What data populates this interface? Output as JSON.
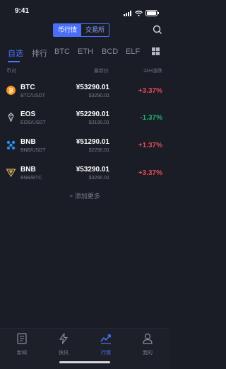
{
  "status": {
    "time": "9:41"
  },
  "segment": {
    "active": "币行情",
    "inactive": "交易所"
  },
  "tabs": [
    {
      "label": "自选"
    },
    {
      "label": "排行"
    },
    {
      "label": "BTC"
    },
    {
      "label": "ETH"
    },
    {
      "label": "BCD"
    },
    {
      "label": "ELF"
    }
  ],
  "columns": {
    "pair": "币对",
    "price": "最新价",
    "change": "24H涨跌"
  },
  "rows": [
    {
      "name": "BTC",
      "pair": "BTC/USDT",
      "price": "¥53290.01",
      "sub_price": "$3290.01",
      "change": "+3.37%",
      "dir": "up",
      "icon": "bitcoin-icon"
    },
    {
      "name": "EOS",
      "pair": "EOS/USDT",
      "price": "¥52290.01",
      "sub_price": "$3190.01",
      "change": "-1.37%",
      "dir": "down",
      "icon": "eos-icon"
    },
    {
      "name": "BNB",
      "pair": "BNB/USDT",
      "price": "¥51290.01",
      "sub_price": "$2290.01",
      "change": "+1.37%",
      "dir": "up",
      "icon": "ripple-icon"
    },
    {
      "name": "BNB",
      "pair": "BNB/BTC",
      "price": "¥53290.01",
      "sub_price": "$3290.01",
      "change": "+3.37%",
      "dir": "up",
      "icon": "tron-icon"
    }
  ],
  "add_more": "+ 添加更多",
  "tabbar": [
    {
      "label": "新闻",
      "icon": "news-icon"
    },
    {
      "label": "快讯",
      "icon": "flash-icon"
    },
    {
      "label": "行情",
      "icon": "market-icon",
      "active": true
    },
    {
      "label": "我的",
      "icon": "profile-icon"
    }
  ],
  "colors": {
    "accent": "#4b76ff",
    "up": "#e34b52",
    "down": "#1fb270",
    "background": "#1a1c26"
  }
}
